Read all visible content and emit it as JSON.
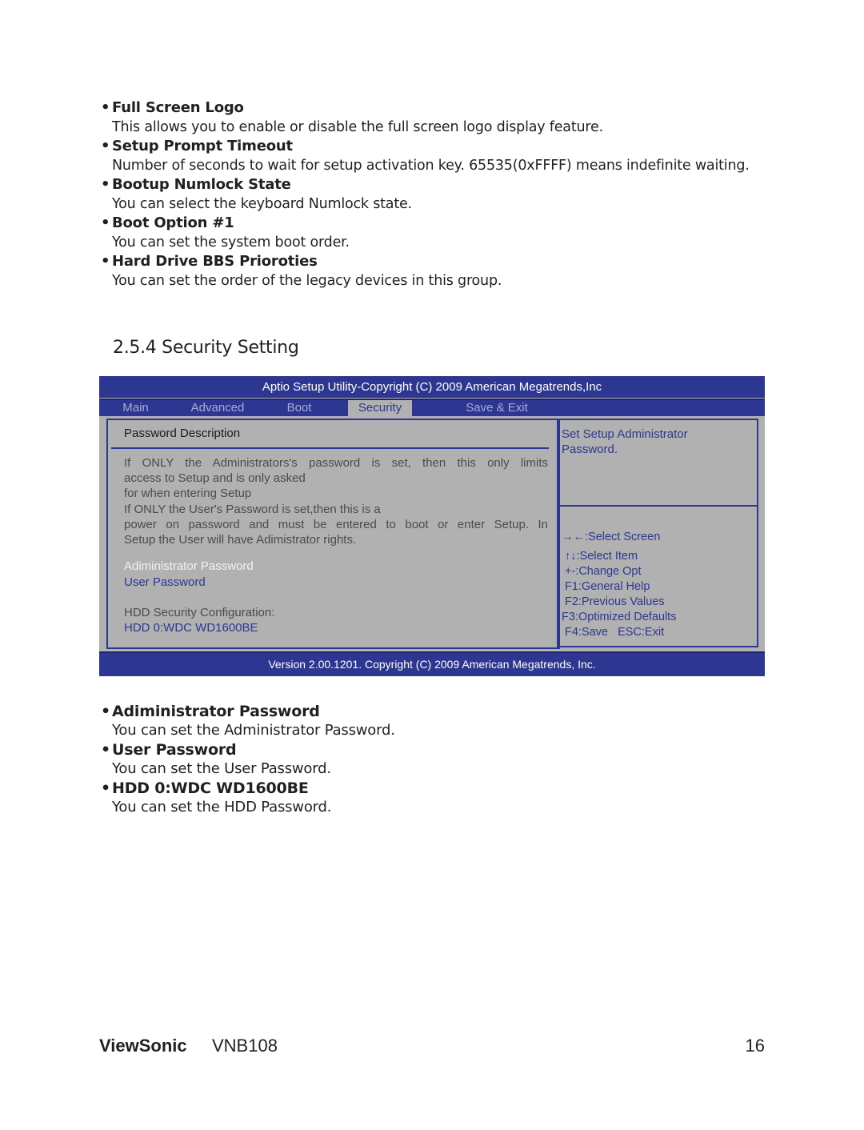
{
  "top_items": [
    {
      "title": "Full Screen Logo",
      "desc": "This allows you to enable or disable the full screen logo display feature."
    },
    {
      "title": "Setup Prompt Timeout",
      "desc": "Number of seconds to wait for setup activation key. 65535(0xFFFF) means indefinite waiting."
    },
    {
      "title": "Bootup Numlock State",
      "desc": "You can select the keyboard Numlock state."
    },
    {
      "title": "Boot Option #1",
      "desc": "You can set the system boot order."
    },
    {
      "title": "Hard Drive BBS Prioroties",
      "desc": "You can set the order of the legacy devices in this group."
    }
  ],
  "section_heading": "2.5.4 Security Setting",
  "bios": {
    "header": "Aptio Setup Utility-Copyright (C) 2009 American Megatrends,Inc",
    "tabs": [
      "Main",
      "Advanced",
      "Boot",
      "Security",
      "Save & Exit"
    ],
    "active_tab": "Security",
    "pw_desc_title": "Password Description",
    "pw_desc_lines": [
      "If ONLY the Administrators's password is set, then this only limits",
      "access to Setup and is only asked",
      "for when entering Setup",
      "If ONLY the User's Password is set,then this is a",
      "power on password and must be entered to boot or enter Setup. In",
      "Setup the User will have Adimistrator rights."
    ],
    "options": {
      "admin_password": "Adiministrator Password",
      "user_password": "User Password",
      "hdd_config_label": "HDD Security Configuration:",
      "hdd_item": "HDD 0:WDC WD1600BE"
    },
    "help_text": [
      "Set Setup Administrator",
      "Password."
    ],
    "keys": [
      "→←:Select Screen",
      "↑↓:Select Item",
      "+-:Change Opt",
      "F1:General Help",
      "F2:Previous Values",
      "F3:Optimized Defaults",
      "F4:Save   ESC:Exit"
    ],
    "footer": "Version 2.00.1201. Copyright (C)  2009 American Megatrends, Inc.",
    "colors": {
      "panel_blue": "#2d3691",
      "panel_gray": "#b1b1b1"
    }
  },
  "bottom_items": [
    {
      "title": "Adiministrator Password",
      "desc": "You can set the Administrator Password."
    },
    {
      "title": "User Password",
      "desc": "You can set the User Password."
    },
    {
      "title": "HDD 0:WDC WD1600BE",
      "desc": "You can set the HDD Password."
    }
  ],
  "footer": {
    "brand": "ViewSonic",
    "model": "VNB108",
    "page": "16"
  }
}
